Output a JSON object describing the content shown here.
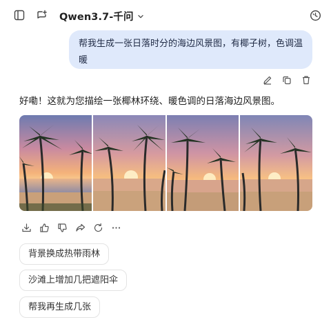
{
  "header": {
    "model_name": "Qwen3.7-千问",
    "icons": [
      "sidebar-toggle-icon",
      "new-chat-icon",
      "chevron-down-icon",
      "history-icon"
    ]
  },
  "conversation": {
    "user_message": "帮我生成一张日落时分的海边风景图，有椰子树，色调温暖",
    "user_actions": [
      "edit-icon",
      "copy-icon",
      "delete-icon"
    ],
    "assistant_reply": "好嘞！这就为您描绘一张椰林环绕、暖色调的日落海边风景图。",
    "image_count": 4,
    "assistant_actions": [
      "download-icon",
      "thumbs-up-icon",
      "thumbs-down-icon",
      "share-icon",
      "regenerate-icon",
      "more-icon"
    ]
  },
  "suggestions": [
    "背景换成热带雨林",
    "沙滩上增加几把遮阳伞",
    "帮我再生成几张"
  ],
  "colors": {
    "bubble": "#dfe9fb",
    "text": "#1f1f1f",
    "icon": "#444444"
  }
}
